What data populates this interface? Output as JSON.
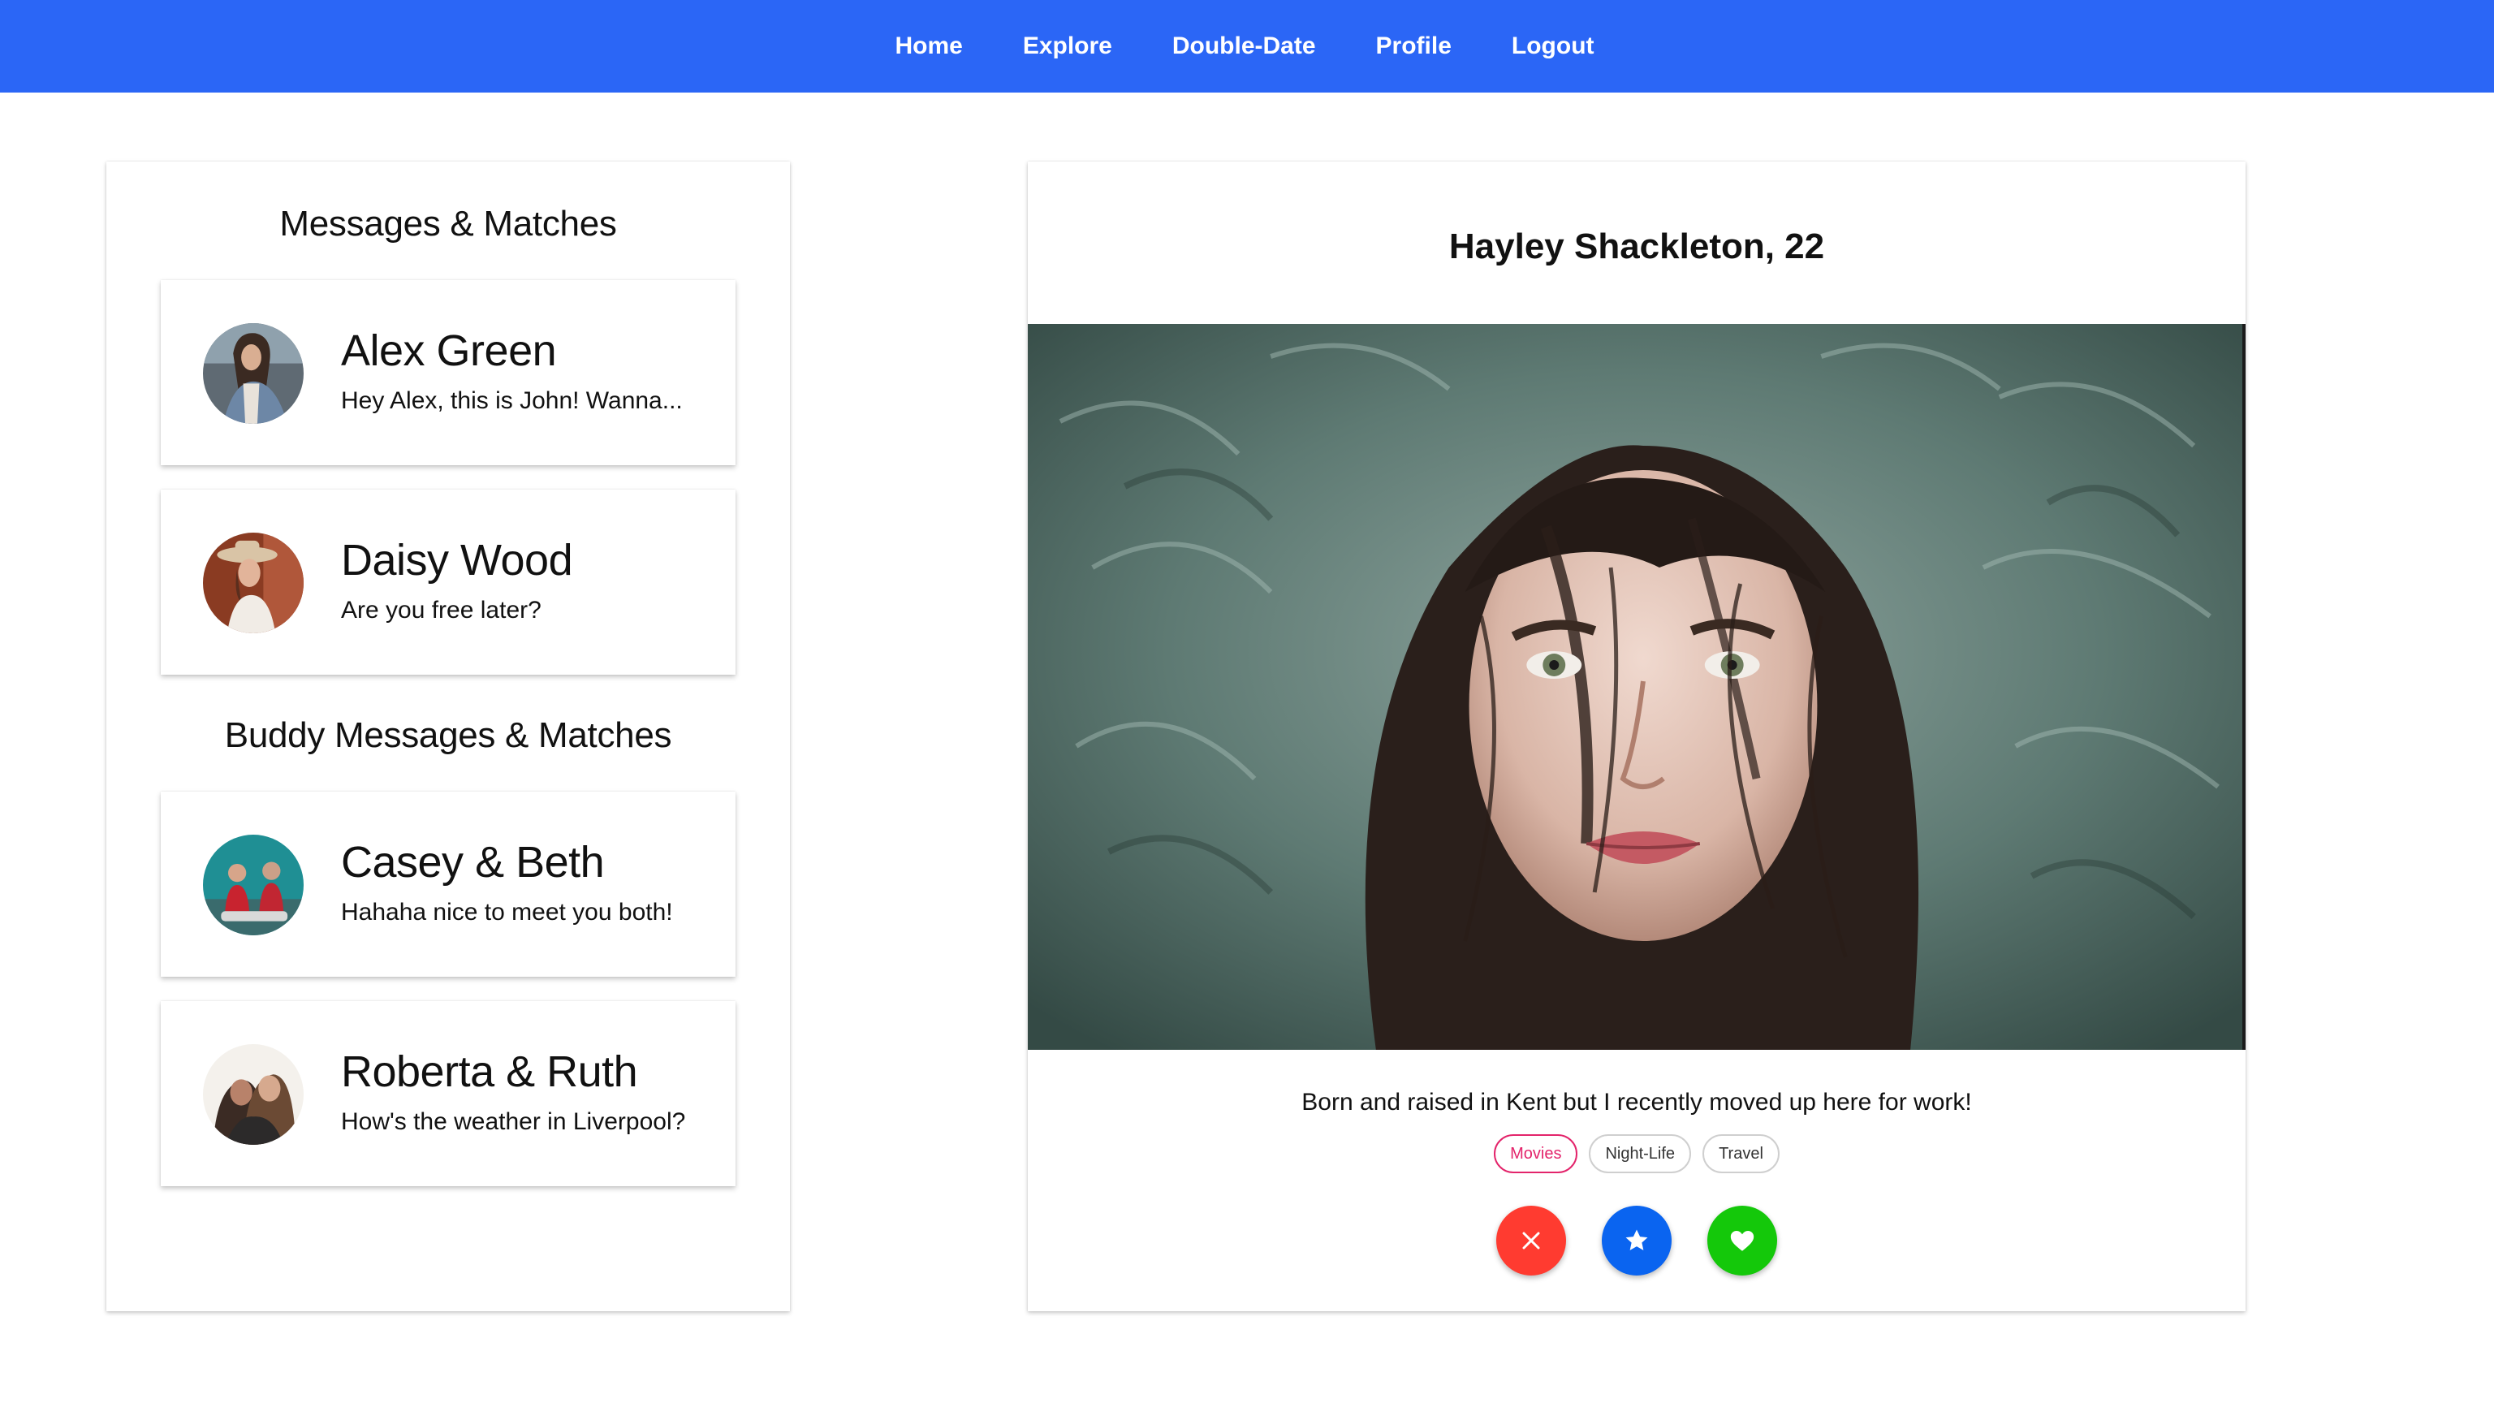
{
  "nav": {
    "items": [
      {
        "label": "Home"
      },
      {
        "label": "Explore"
      },
      {
        "label": "Double-Date"
      },
      {
        "label": "Profile"
      },
      {
        "label": "Logout"
      }
    ]
  },
  "sidebar": {
    "messages_title": "Messages & Matches",
    "messages": [
      {
        "name": "Alex Green",
        "preview": "Hey Alex, this is John! Wanna..."
      },
      {
        "name": "Daisy Wood",
        "preview": "Are you free later?"
      }
    ],
    "buddy_title": "Buddy Messages & Matches",
    "buddy_messages": [
      {
        "name": "Casey & Beth",
        "preview": "Hahaha nice to meet you both!"
      },
      {
        "name": "Roberta & Ruth",
        "preview": "How's the weather in Liverpool?"
      }
    ]
  },
  "profile": {
    "heading": "Hayley Shackleton, 22",
    "bio": "Born and raised in Kent but I recently moved up here for work!",
    "tags": [
      {
        "label": "Movies",
        "active": true
      },
      {
        "label": "Night-Life",
        "active": false
      },
      {
        "label": "Travel",
        "active": false
      }
    ],
    "actions": [
      {
        "icon": "close-icon",
        "color": "#ff3b30"
      },
      {
        "icon": "star-icon",
        "color": "#0a64f0"
      },
      {
        "icon": "heart-icon",
        "color": "#14c80a"
      }
    ]
  },
  "colors": {
    "nav_background": "#2b66f6",
    "tag_active": "#e3246b"
  }
}
